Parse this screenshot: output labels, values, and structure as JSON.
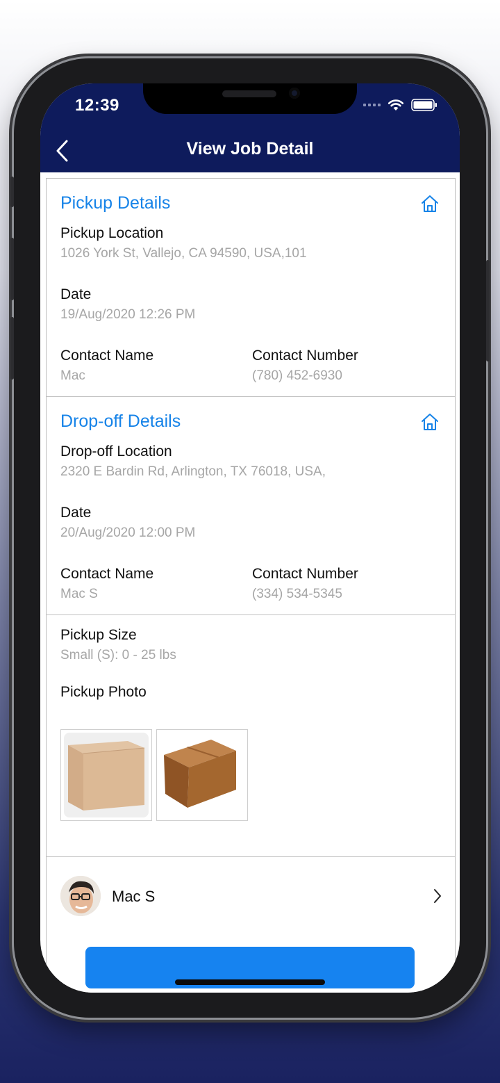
{
  "status_bar": {
    "time": "12:39"
  },
  "nav": {
    "title": "View Job Detail"
  },
  "pickup": {
    "title": "Pickup Details",
    "location_label": "Pickup Location",
    "location_value": "1026 York St, Vallejo, CA 94590, USA,101",
    "date_label": "Date",
    "date_value": "19/Aug/2020 12:26 PM",
    "contact_name_label": "Contact Name",
    "contact_name_value": "Mac",
    "contact_number_label": "Contact Number",
    "contact_number_value": "(780) 452-6930"
  },
  "dropoff": {
    "title": "Drop-off Details",
    "location_label": "Drop-off Location",
    "location_value": "2320 E Bardin Rd, Arlington, TX 76018, USA,",
    "date_label": "Date",
    "date_value": "20/Aug/2020 12:00 PM",
    "contact_name_label": "Contact Name",
    "contact_name_value": "Mac S",
    "contact_number_label": "Contact Number",
    "contact_number_value": "(334) 534-5345"
  },
  "package": {
    "size_label": "Pickup Size",
    "size_value": "Small (S): 0 - 25 lbs",
    "photo_label": "Pickup Photo"
  },
  "driver": {
    "name": "Mac S"
  },
  "colors": {
    "nav_bg": "#0e1b5c",
    "accent": "#1683e8",
    "button": "#1683f0"
  },
  "icons": [
    "chevron-left-icon",
    "home-icon",
    "chevron-right-icon",
    "wifi-icon",
    "battery-icon"
  ]
}
